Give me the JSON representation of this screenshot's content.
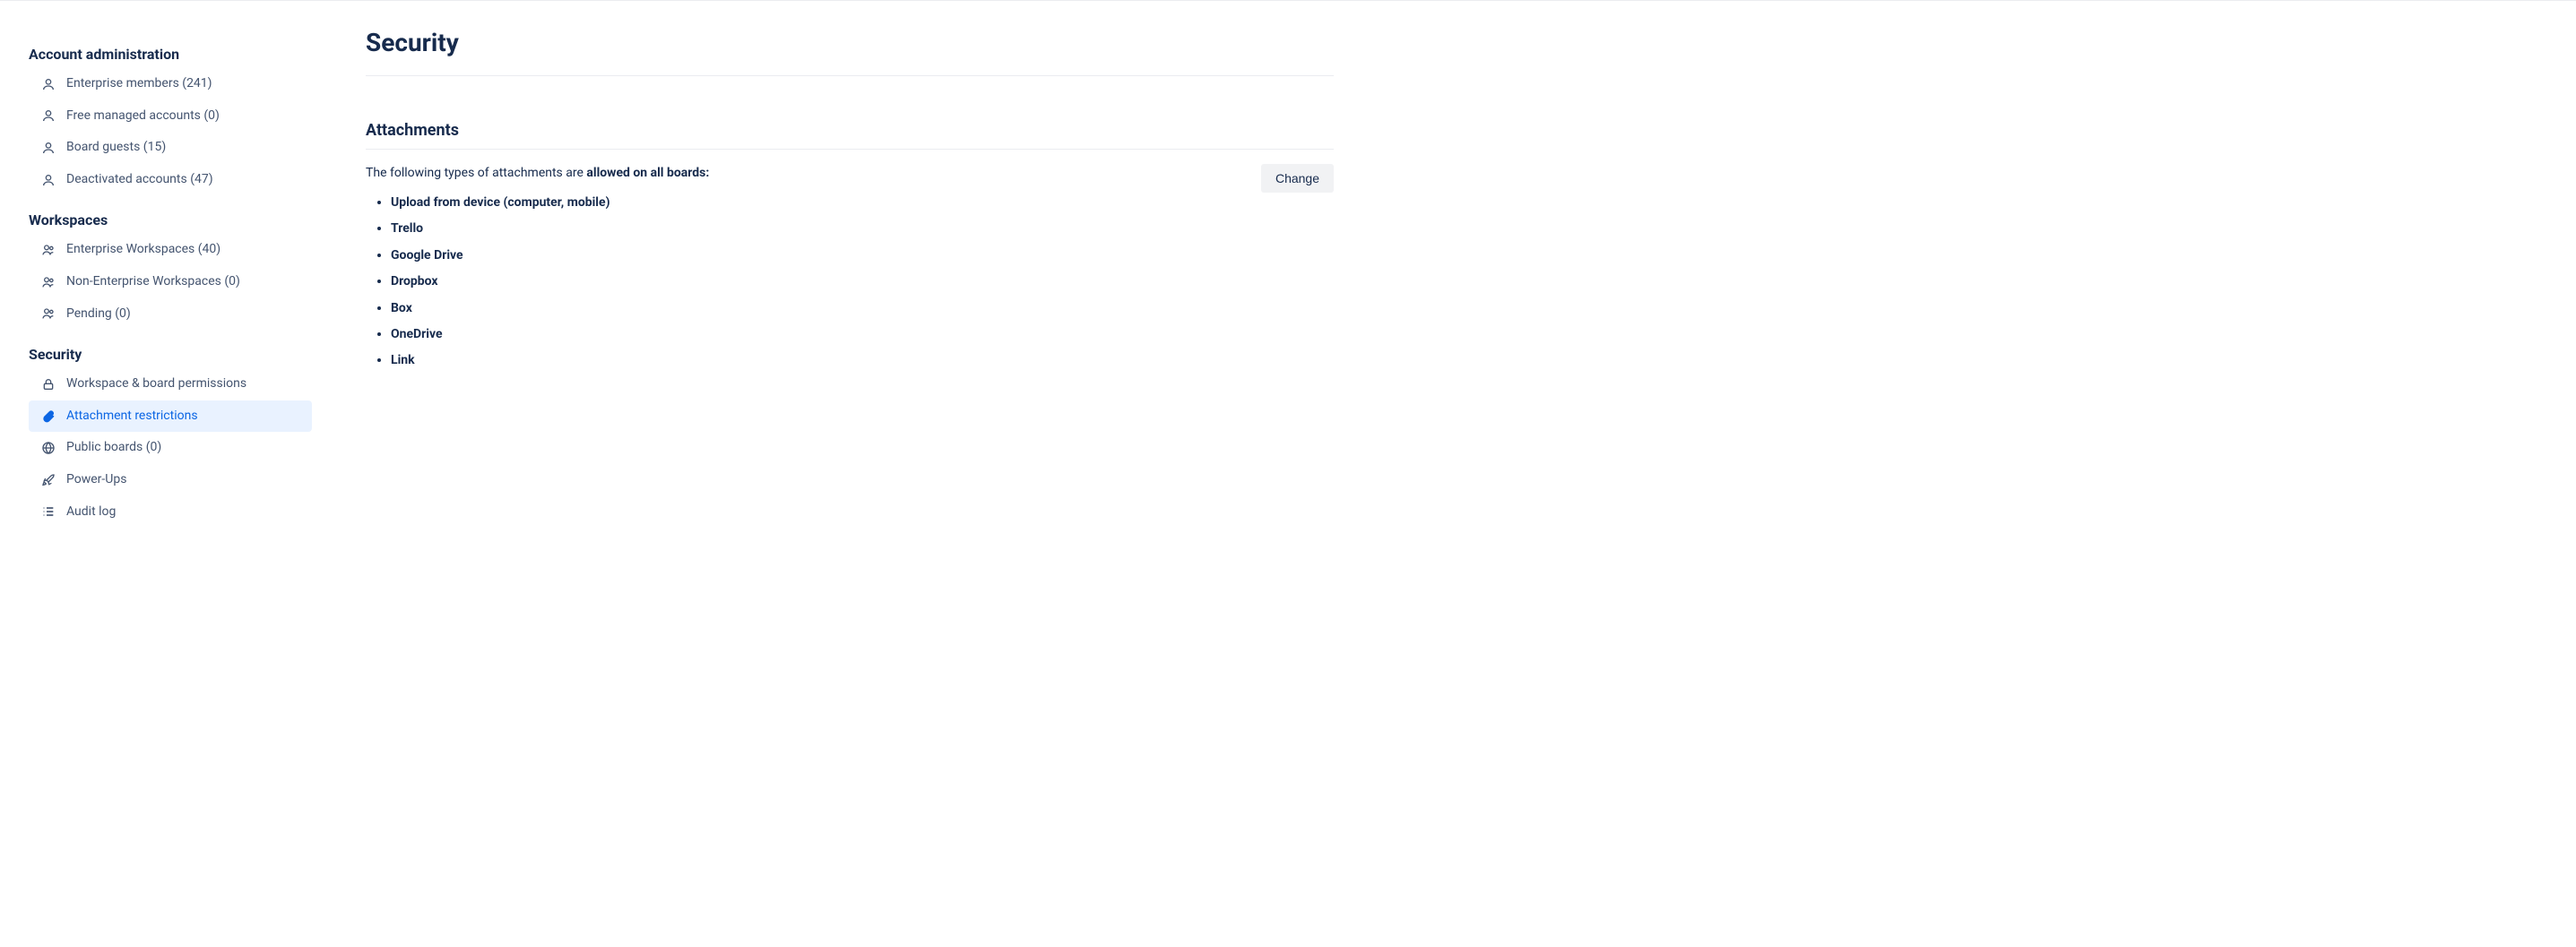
{
  "sidebar": {
    "section1_title": "Account administration",
    "section1_items": [
      {
        "label": "Enterprise members (241)",
        "name": "sidebar-item-enterprise-members",
        "icon": "person"
      },
      {
        "label": "Free managed accounts (0)",
        "name": "sidebar-item-free-managed-accounts",
        "icon": "person"
      },
      {
        "label": "Board guests (15)",
        "name": "sidebar-item-board-guests",
        "icon": "person"
      },
      {
        "label": "Deactivated accounts (47)",
        "name": "sidebar-item-deactivated-accounts",
        "icon": "person"
      }
    ],
    "section2_title": "Workspaces",
    "section2_items": [
      {
        "label": "Enterprise Workspaces (40)",
        "name": "sidebar-item-enterprise-workspaces",
        "icon": "people"
      },
      {
        "label": "Non-Enterprise Workspaces (0)",
        "name": "sidebar-item-non-enterprise-workspaces",
        "icon": "people"
      },
      {
        "label": "Pending (0)",
        "name": "sidebar-item-pending",
        "icon": "people"
      }
    ],
    "section3_title": "Security",
    "section3_items": [
      {
        "label": "Workspace & board permissions",
        "name": "sidebar-item-workspace-board-permissions",
        "icon": "lock",
        "active": false
      },
      {
        "label": "Attachment restrictions",
        "name": "sidebar-item-attachment-restrictions",
        "icon": "attachment",
        "active": true
      },
      {
        "label": "Public boards (0)",
        "name": "sidebar-item-public-boards",
        "icon": "globe",
        "active": false
      },
      {
        "label": "Power-Ups",
        "name": "sidebar-item-power-ups",
        "icon": "rocket",
        "active": false
      },
      {
        "label": "Audit log",
        "name": "sidebar-item-audit-log",
        "icon": "list",
        "active": false
      }
    ]
  },
  "main": {
    "page_title": "Security",
    "attachments": {
      "section_title": "Attachments",
      "intro_prefix": "The following types of attachments are ",
      "intro_strong": "allowed on all boards:",
      "items": [
        "Upload from device (computer, mobile)",
        "Trello",
        "Google Drive",
        "Dropbox",
        "Box",
        "OneDrive",
        "Link"
      ],
      "change_label": "Change"
    }
  }
}
